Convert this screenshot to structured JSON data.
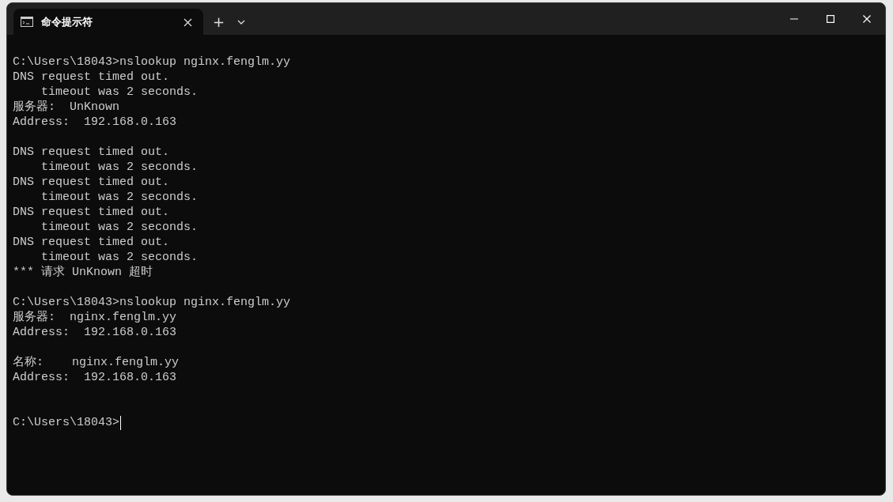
{
  "window": {
    "tab": {
      "title": "命令提示符",
      "selected": true
    },
    "new_tab": "+"
  },
  "lines": [
    {
      "kind": "text",
      "text": "C:\\Users\\18043>nslookup nginx.fenglm.yy"
    },
    {
      "kind": "text",
      "text": "DNS request timed out."
    },
    {
      "kind": "text",
      "text": "    timeout was 2 seconds."
    },
    {
      "kind": "text",
      "text": "服务器:  UnKnown"
    },
    {
      "kind": "text",
      "text": "Address:  192.168.0.163"
    },
    {
      "kind": "blank"
    },
    {
      "kind": "text",
      "text": "DNS request timed out."
    },
    {
      "kind": "text",
      "text": "    timeout was 2 seconds."
    },
    {
      "kind": "text",
      "text": "DNS request timed out."
    },
    {
      "kind": "text",
      "text": "    timeout was 2 seconds."
    },
    {
      "kind": "text",
      "text": "DNS request timed out."
    },
    {
      "kind": "text",
      "text": "    timeout was 2 seconds."
    },
    {
      "kind": "text",
      "text": "DNS request timed out."
    },
    {
      "kind": "text",
      "text": "    timeout was 2 seconds."
    },
    {
      "kind": "text",
      "text": "*** 请求 UnKnown 超时"
    },
    {
      "kind": "blank"
    },
    {
      "kind": "text",
      "text": "C:\\Users\\18043>nslookup nginx.fenglm.yy"
    },
    {
      "kind": "text",
      "text": "服务器:  nginx.fenglm.yy"
    },
    {
      "kind": "text",
      "text": "Address:  192.168.0.163"
    },
    {
      "kind": "blank"
    },
    {
      "kind": "text",
      "text": "名称:    nginx.fenglm.yy"
    },
    {
      "kind": "text",
      "text": "Address:  192.168.0.163"
    },
    {
      "kind": "blank"
    },
    {
      "kind": "blank"
    },
    {
      "kind": "prompt",
      "text": "C:\\Users\\18043>"
    }
  ]
}
